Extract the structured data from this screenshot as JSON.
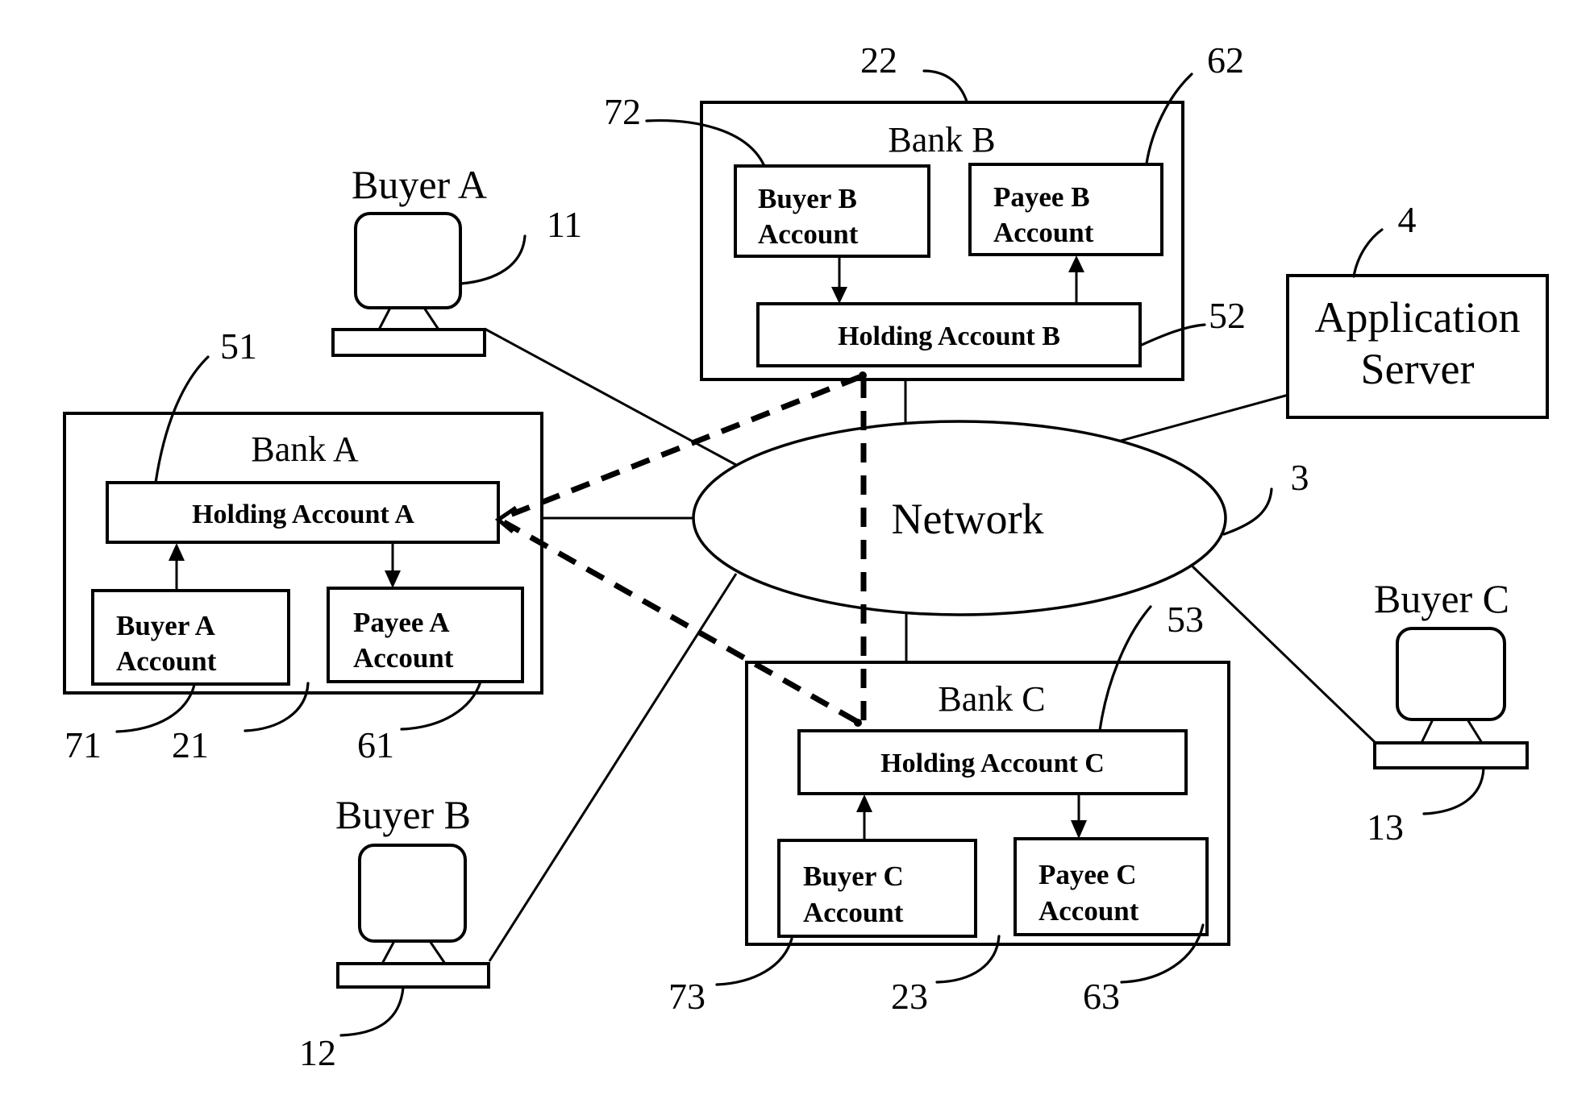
{
  "diagram": {
    "network": {
      "label": "Network",
      "ref": "3"
    },
    "application_server": {
      "label_line1": "Application",
      "label_line2": "Server",
      "ref": "4"
    },
    "buyers": [
      {
        "label": "Buyer A",
        "ref": "11"
      },
      {
        "label": "Buyer B",
        "ref": "12"
      },
      {
        "label": "Buyer C",
        "ref": "13"
      }
    ],
    "banks": [
      {
        "label": "Bank A",
        "ref": "21",
        "holding": {
          "label": "Holding Account A",
          "ref": "51"
        },
        "payee": {
          "line1": "Payee A",
          "line2": "Account",
          "ref": "61"
        },
        "buyer": {
          "line1": "Buyer A",
          "line2": "Account",
          "ref": "71"
        }
      },
      {
        "label": "Bank B",
        "ref": "22",
        "holding": {
          "label": "Holding Account B",
          "ref": "52"
        },
        "payee": {
          "line1": "Payee B",
          "line2": "Account",
          "ref": "62"
        },
        "buyer": {
          "line1": "Buyer B",
          "line2": "Account",
          "ref": "72"
        }
      },
      {
        "label": "Bank C",
        "ref": "23",
        "holding": {
          "label": "Holding Account C",
          "ref": "53"
        },
        "payee": {
          "line1": "Payee C",
          "line2": "Account",
          "ref": "63"
        },
        "buyer": {
          "line1": "Buyer C",
          "line2": "Account",
          "ref": "73"
        }
      }
    ],
    "links": [
      {
        "from": "Buyer A",
        "to": "Network",
        "style": "solid"
      },
      {
        "from": "Buyer B",
        "to": "Network",
        "style": "solid"
      },
      {
        "from": "Buyer C",
        "to": "Network",
        "style": "solid"
      },
      {
        "from": "Bank A",
        "to": "Network",
        "style": "solid"
      },
      {
        "from": "Bank B",
        "to": "Network",
        "style": "solid"
      },
      {
        "from": "Bank C",
        "to": "Network",
        "style": "solid"
      },
      {
        "from": "Application Server",
        "to": "Network",
        "style": "solid"
      },
      {
        "from": "Holding Account B",
        "to": "Holding Account A",
        "style": "dashed"
      },
      {
        "from": "Holding Account C",
        "to": "Holding Account A",
        "style": "dashed"
      },
      {
        "from": "Holding Account B",
        "to": "Holding Account C",
        "style": "dashed"
      }
    ]
  }
}
